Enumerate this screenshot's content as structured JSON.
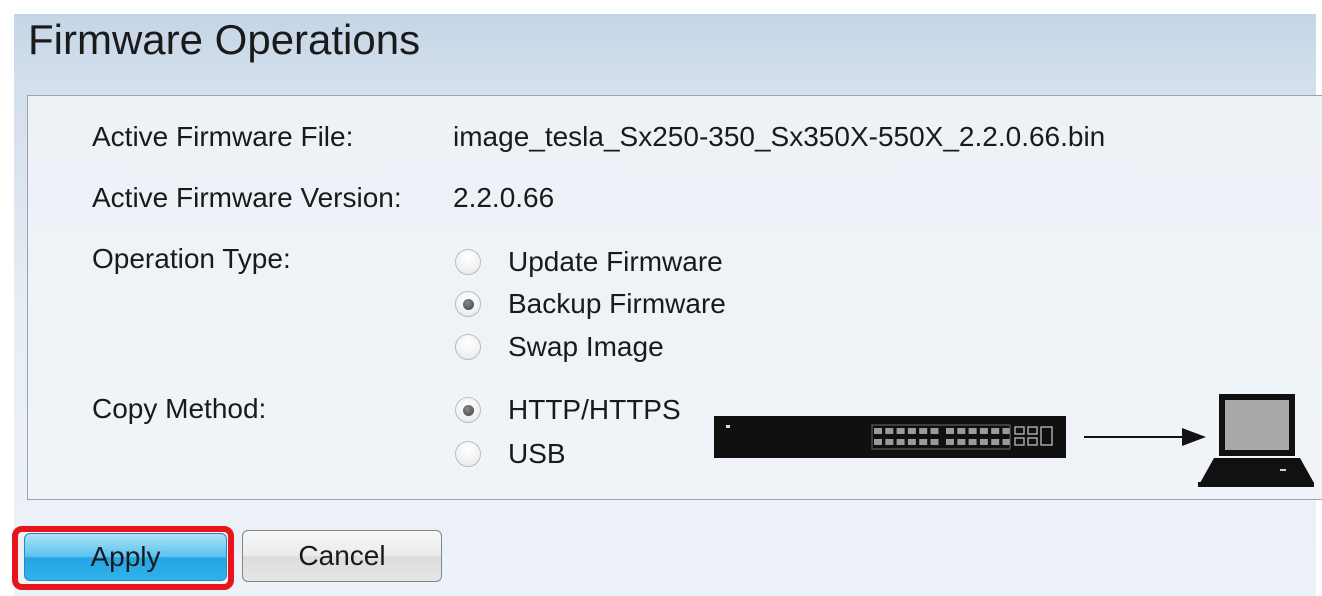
{
  "page": {
    "title": "Firmware Operations"
  },
  "form": {
    "active_file_label": "Active Firmware File:",
    "active_file_value": "image_tesla_Sx250-350_Sx350X-550X_2.2.0.66.bin",
    "active_version_label": "Active Firmware Version:",
    "active_version_value": "2.2.0.66",
    "operation_type": {
      "label": "Operation Type:",
      "options": [
        {
          "label": "Update Firmware",
          "checked": false
        },
        {
          "label": "Backup Firmware",
          "checked": true
        },
        {
          "label": "Swap Image",
          "checked": false
        }
      ]
    },
    "copy_method": {
      "label": "Copy Method:",
      "options": [
        {
          "label": "HTTP/HTTPS",
          "checked": true
        },
        {
          "label": "USB",
          "checked": false
        }
      ]
    }
  },
  "illustration": {
    "icons": [
      "network-switch-icon",
      "arrow-right-icon",
      "laptop-icon"
    ]
  },
  "buttons": {
    "apply_label": "Apply",
    "cancel_label": "Cancel"
  },
  "colors": {
    "highlight": "#e8141b",
    "apply_button": "#2fb2ec"
  }
}
